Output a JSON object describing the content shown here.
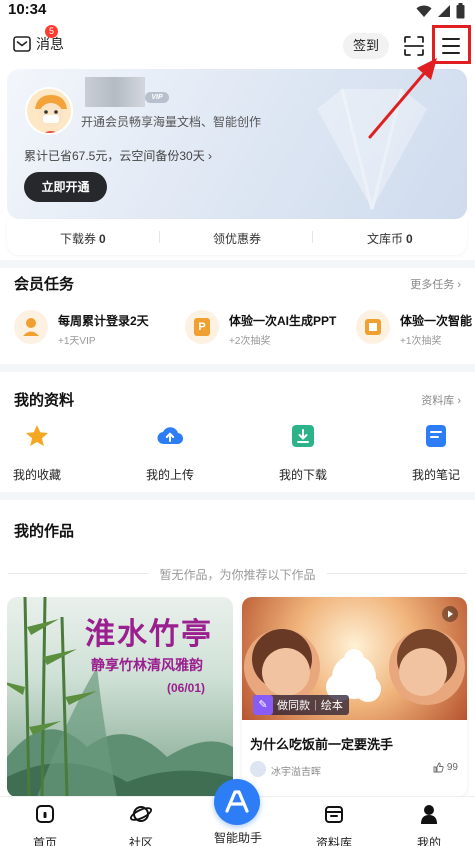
{
  "status_bar": {
    "time": "10:34"
  },
  "header": {
    "messages_label": "消息",
    "messages_badge": "5",
    "signin_label": "签到"
  },
  "vip_card": {
    "vip_tag": "VIP",
    "description": "开通会员畅享海量文档、智能创作",
    "saved_text": "累计已省67.5元，云空间备份30天 ›",
    "open_button": "立即开通"
  },
  "coupons": [
    {
      "label": "下载券",
      "value": "0"
    },
    {
      "label": "领优惠券",
      "value": ""
    },
    {
      "label": "文库币",
      "value": "0"
    }
  ],
  "member_tasks": {
    "title": "会员任务",
    "more": "更多任务 ›",
    "items": [
      {
        "icon": "P",
        "title": "每周累计登录2天",
        "reward": "+1天VIP"
      },
      {
        "icon": "P",
        "title": "体验一次AI生成PPT",
        "reward": "+2次抽奖"
      },
      {
        "icon": "P",
        "title": "体验一次智能",
        "reward": "+1次抽奖"
      }
    ]
  },
  "my_resources": {
    "title": "我的资料",
    "more": "资料库 ›",
    "items": [
      {
        "label": "我的收藏",
        "icon": "star-icon"
      },
      {
        "label": "我的上传",
        "icon": "cloud-upload-icon"
      },
      {
        "label": "我的下载",
        "icon": "download-icon"
      },
      {
        "label": "我的笔记",
        "icon": "note-icon"
      }
    ]
  },
  "my_works": {
    "title": "我的作品",
    "empty_text": "暂无作品，为你推荐以下作品",
    "cards": [
      {
        "poster_title": "淮水竹亭",
        "poster_subtitle": "静享竹林清风雅韵",
        "poster_date": "(06/01)"
      },
      {
        "tag_primary": "做同款",
        "tag_secondary": "绘本",
        "title": "为什么吃饭前一定要洗手",
        "author": "冰宇溢吉晖",
        "likes": "99"
      }
    ]
  },
  "bottom_nav": [
    {
      "label": "首页",
      "icon": "home-icon"
    },
    {
      "label": "社区",
      "icon": "planet-icon"
    },
    {
      "label": "智能助手",
      "icon": "assistant-icon"
    },
    {
      "label": "资料库",
      "icon": "library-icon"
    },
    {
      "label": "我的",
      "icon": "profile-icon"
    }
  ],
  "colors": {
    "accent_blue": "#2c7df6",
    "annotation_red": "#e02020",
    "poster_purple": "#9a1f8f",
    "task_orange": "#f0a030"
  }
}
